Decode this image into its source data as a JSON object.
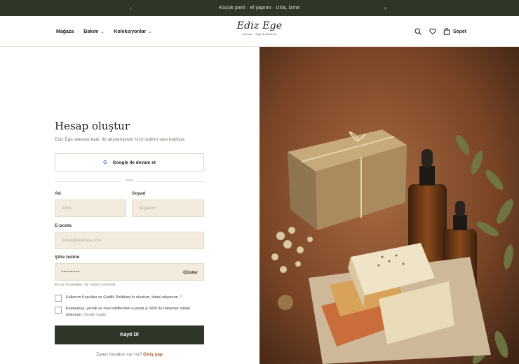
{
  "announcement": {
    "text": "Küçük parti · el yapımı · Urla, İzmir",
    "prev_icon": "chevron-left-icon",
    "next_icon": "chevron-right-icon"
  },
  "nav": {
    "items": [
      {
        "label": "Mağaza"
      },
      {
        "label": "Bakım"
      },
      {
        "label": "Koleksiyonlar"
      }
    ]
  },
  "brand": {
    "name": "Ediz Ege",
    "tagline": "Artisan · Ege & Akdeniz"
  },
  "header_actions": {
    "search_icon": "search-icon",
    "wishlist_icon": "heart-icon",
    "cart_icon": "bag-icon",
    "cart_label": "Sepet"
  },
  "form": {
    "title": "Hesap oluştur",
    "subtitle": "Ediz Ege ailesine katıl. İlk alışverişinde %10 indirim seni bekliyor.",
    "google_button": "Google ile devam et",
    "divider": "veya",
    "first_name": {
      "label": "Ad",
      "placeholder": "Adın"
    },
    "last_name": {
      "label": "Soyad",
      "placeholder": "Soyadın"
    },
    "email": {
      "label": "E-posta",
      "placeholder": "ornek@eposta.com"
    },
    "password": {
      "label": "Şifre belirle",
      "value": "••••••••",
      "toggle": "Göster",
      "hint": "En az 8 karakter, bir rakam içermeli."
    },
    "terms_checkbox": "Kullanım Koşulları ve Gizlilik Politikası'nı okudum, kabul ediyorum. *",
    "marketing_checkbox_line1": "Kampanya, yenilik ve özel tekliflerden e-posta & SMS ile haberdar olmak",
    "marketing_checkbox_line2": "istiyorum.",
    "marketing_optional": "(İsteğe bağlı)",
    "submit": "Kayıt Ol",
    "login_prompt": "Zaten hesabın var mı?",
    "login_link": "Giriş yap"
  },
  "colors": {
    "announce_bg": "#2f3527",
    "button_bg": "#2f3527",
    "input_bg": "#f3ecde",
    "link": "#a2552c"
  }
}
